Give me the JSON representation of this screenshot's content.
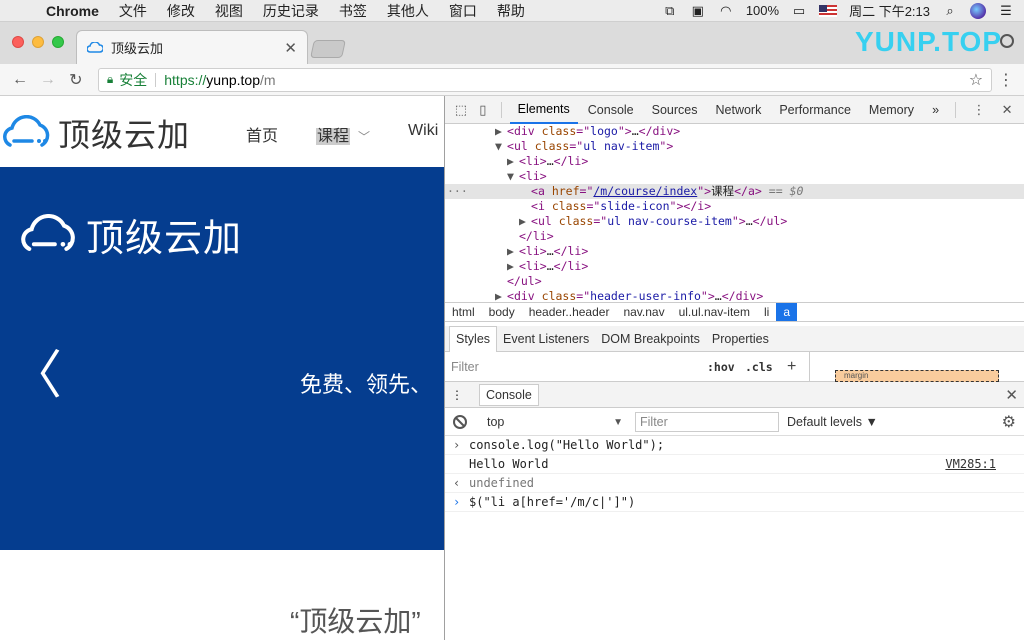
{
  "menubar": {
    "app_name": "Chrome",
    "items": [
      "文件",
      "修改",
      "视图",
      "历史记录",
      "书签",
      "其他人",
      "窗口",
      "帮助"
    ],
    "battery": "100%",
    "datetime": "周二 下午2:13"
  },
  "tab": {
    "title": "顶级云加"
  },
  "watermark": "YUNP.TOP",
  "address": {
    "secure_label": "安全",
    "scheme": "https://",
    "host": "yunp.top",
    "path": "/m"
  },
  "site": {
    "logo_text": "顶级云加",
    "nav": [
      "首页",
      "课程",
      "Wiki"
    ],
    "banner_logo_text": "顶级云加",
    "banner_slogan": "免费、领先、",
    "quote": "“顶级云加”"
  },
  "devtools": {
    "tabs": [
      "Elements",
      "Console",
      "Sources",
      "Network",
      "Performance",
      "Memory"
    ],
    "overflow": "»",
    "dom": {
      "l1_tag": "div",
      "l1_attr": "class",
      "l1_val": "logo",
      "l2_tag": "ul",
      "l2_attr": "class",
      "l2_val": "ul nav-item",
      "l5_tag": "a",
      "l5_attr": "href",
      "l5_val": "/m/course/index",
      "l5_text": "课程",
      "l5_marker": "== $0",
      "l6_tag": "i",
      "l6_attr": "class",
      "l6_val": "slide-icon",
      "l7_tag": "ul",
      "l7_attr": "class",
      "l7_val": "ul nav-course-item",
      "l12_tag": "div",
      "l12_attr": "class",
      "l12_val": "header-user-info"
    },
    "breadcrumbs": [
      "html",
      "body",
      "header..header",
      "nav.nav",
      "ul.ul.nav-item",
      "li",
      "a"
    ],
    "styles_tabs": [
      "Styles",
      "Event Listeners",
      "DOM Breakpoints",
      "Properties"
    ],
    "styles_filter_placeholder": "Filter",
    "hov": ":hov",
    "cls": ".cls",
    "boxmodel_label": "margin",
    "drawer_tab": "Console",
    "context": "top",
    "console_filter_placeholder": "Filter",
    "levels": "Default levels ▼",
    "console": {
      "cmd1": "console.log(\"Hello World\");",
      "out1": "Hello World",
      "out1_src": "VM285:1",
      "result1": "undefined",
      "input": "$(\"li a[href='/m/c|']\")"
    }
  },
  "colors": {
    "banner": "#053d8f",
    "watermark": "#37d0f0",
    "accent": "#1a73e8"
  }
}
